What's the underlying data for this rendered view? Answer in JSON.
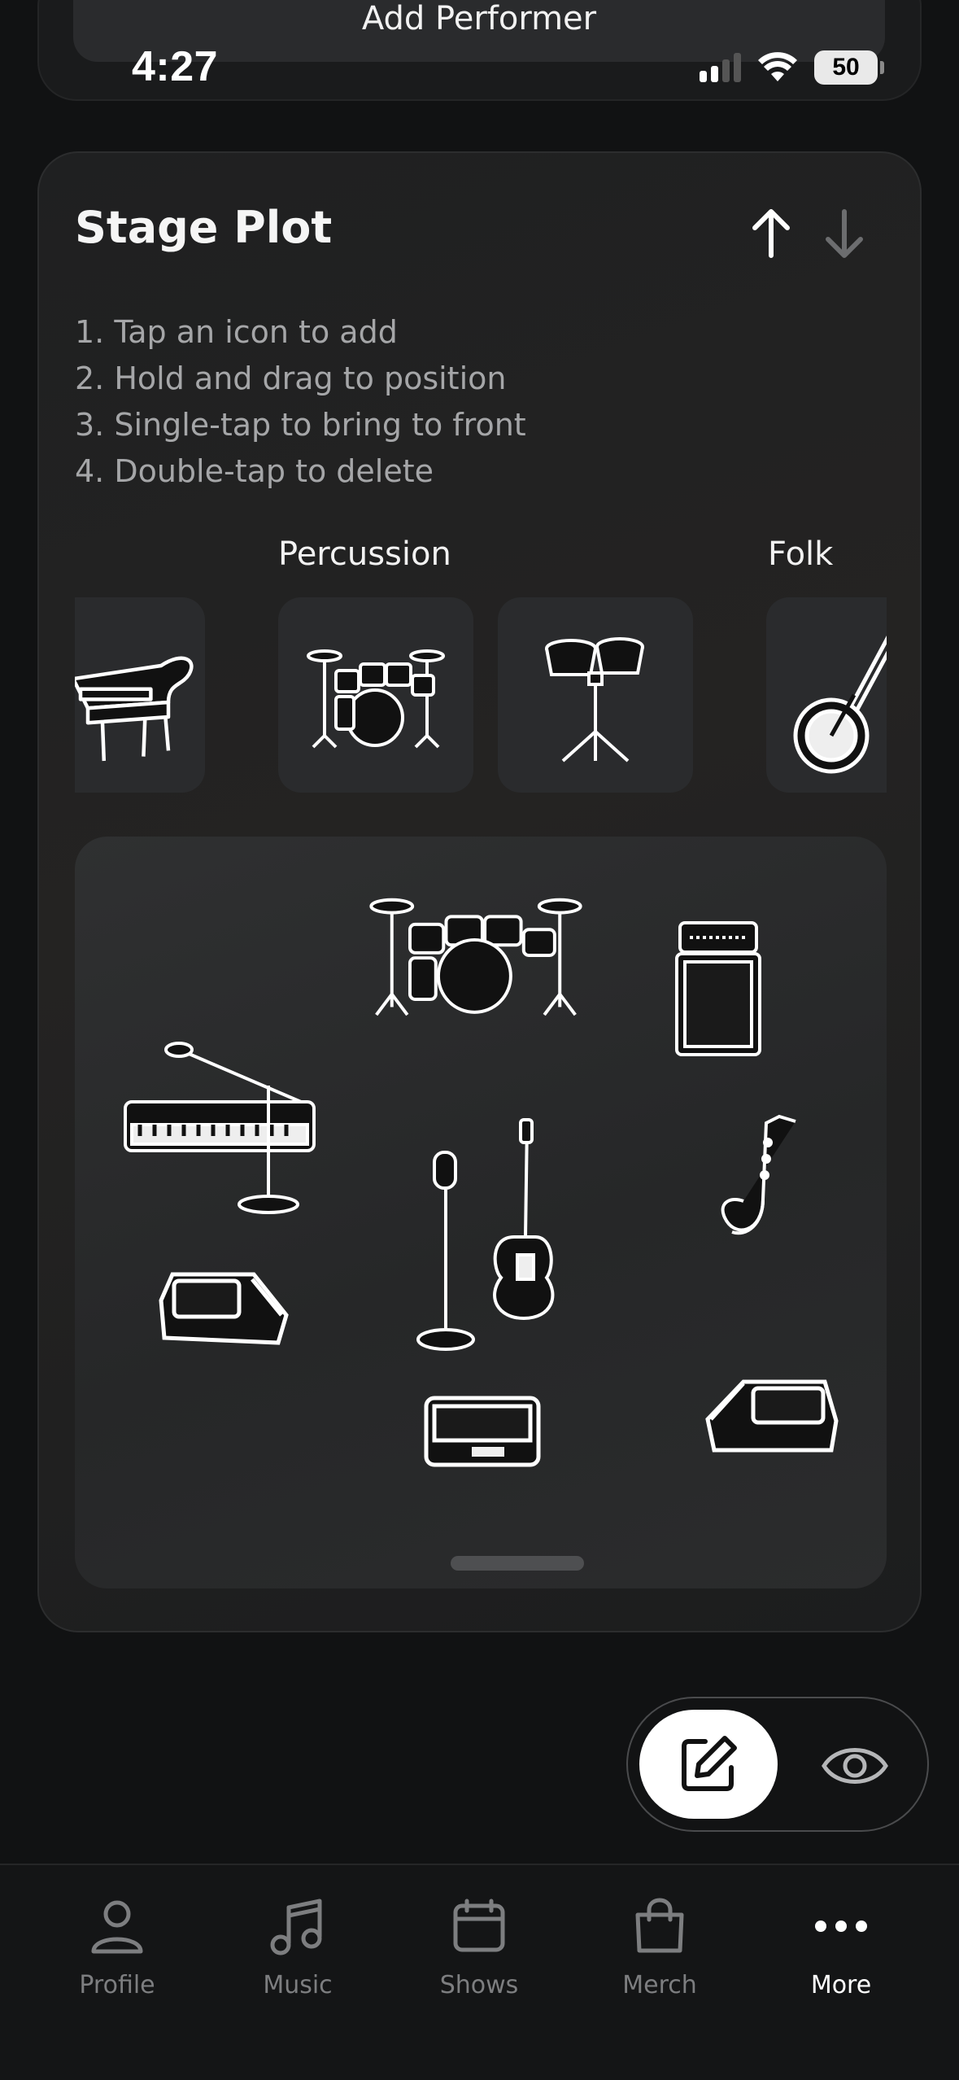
{
  "previous_card": {
    "button_label": "Add Performer"
  },
  "status_bar": {
    "time": "4:27",
    "battery": "50"
  },
  "stage_plot": {
    "title": "Stage Plot",
    "instructions": [
      "1. Tap an icon to add",
      "2. Hold and drag to position",
      "3. Single-tap to bring to front",
      "4. Double-tap to delete"
    ],
    "palette": {
      "categories": [
        "Percussion",
        "Folk"
      ],
      "items": [
        "grand-piano",
        "drum-kit",
        "bongos",
        "banjo"
      ]
    },
    "stage_items": [
      "drum-kit",
      "guitar-amp",
      "keyboard-with-mic-stand",
      "mic-stand",
      "electric-guitar",
      "saxophone",
      "stage-monitor",
      "di-box",
      "stage-monitor"
    ]
  },
  "mode_toggle": {
    "edit_icon": "edit-icon",
    "view_icon": "eye-icon",
    "active": "edit"
  },
  "tabbar": {
    "tabs": [
      {
        "label": "Profile",
        "icon": "person-icon"
      },
      {
        "label": "Music",
        "icon": "music-note-icon"
      },
      {
        "label": "Shows",
        "icon": "calendar-icon"
      },
      {
        "label": "Merch",
        "icon": "bag-icon"
      },
      {
        "label": "More",
        "icon": "more-dots-icon"
      }
    ],
    "active_tab": "More"
  },
  "colors": {
    "background": "#111213",
    "card": "#1f2021",
    "stage": "#2b2c2d",
    "inactive_tab": "#7d7e80"
  }
}
